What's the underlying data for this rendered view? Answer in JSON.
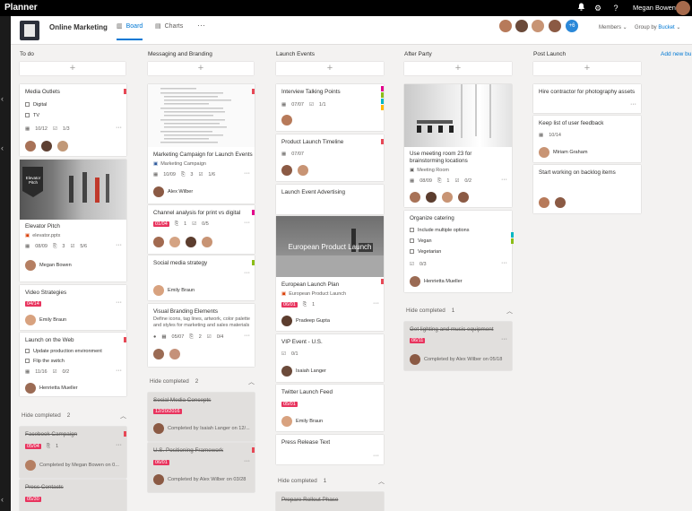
{
  "app": {
    "title": "Planner",
    "user": "Megan Bowen"
  },
  "header": {
    "plan_name": "Online Marketing",
    "tabs": [
      {
        "label": "Board"
      },
      {
        "label": "Charts"
      }
    ],
    "more": "···",
    "extra_members": "+6",
    "members_label": "Members",
    "group_prefix": "Group by",
    "group_value": "Bucket"
  },
  "board": {
    "add_bucket": "Add new bu",
    "add_symbol": "+",
    "more": "···",
    "to_do": {
      "title": "To do",
      "media_outlets": {
        "title": "Media Outlets",
        "check1": "Digital",
        "check2": "TV",
        "date": "10/12",
        "progress": "1/3"
      },
      "elevator": {
        "img_title": "Elevator Pitch",
        "title": "Elevator Pitch",
        "file": "elevator.pptx",
        "date": "08/09",
        "attach": "3",
        "progress": "5/6",
        "person": "Megan Bowen"
      },
      "video": {
        "title": "Video Strategies",
        "date": "04/14",
        "person": "Emily Braun"
      },
      "launch_web": {
        "title": "Launch on the Web",
        "check1": "Update production environment",
        "check2": "Flip the switch",
        "date": "11/16",
        "progress": "0/2",
        "person": "Henrietta Mueller"
      },
      "hide_completed": "Hide completed",
      "completed_count": "2",
      "fb": {
        "title": "Facebook Campaign",
        "date": "05/04",
        "attach": "1",
        "status": "Completed by Megan Bowen on 0..."
      },
      "press": {
        "title": "Press Contacts",
        "date": "05/30"
      }
    },
    "messaging": {
      "title": "Messaging and Branding",
      "campaign": {
        "title": "Marketing Campaign for Launch Events",
        "file": "Marketing Campaign",
        "date": "10/09",
        "attach": "3",
        "progress": "1/6",
        "person": "Alex Wilber"
      },
      "channel": {
        "title": "Channel analysis for print vs digital",
        "date": "01/04",
        "attach": "1",
        "progress": "0/5"
      },
      "social": {
        "title": "Social media strategy",
        "person": "Emily Braun"
      },
      "visual": {
        "title": "Visual Branding Elements",
        "desc": "Define icons, tag lines, artwork, color palette and styles for marketing and sales materials",
        "date": "05/07",
        "attach": "2",
        "progress": "0/4"
      },
      "hide_completed": "Hide completed",
      "completed_count": "2",
      "smc": {
        "title": "Social Media Concepts",
        "date": "12/20/2016",
        "status": "Completed by Isaiah Langer on 12/..."
      },
      "usp": {
        "title": "U.S. Positioning Framework",
        "date": "06/01",
        "status": "Completed by Alex Wilber on 03/28"
      }
    },
    "launch": {
      "title": "Launch Events",
      "interview": {
        "title": "Interview Talking Points",
        "date": "07/07",
        "progress": "1/1"
      },
      "timeline": {
        "title": "Product Launch Timeline",
        "date": "07/07"
      },
      "advert": {
        "title": "Launch Event Advertising"
      },
      "european": {
        "img_title": "European Product Launch",
        "title": "European Launch Plan",
        "file": "European Product Launch",
        "date": "06/01",
        "attach": "1",
        "person": "Pradeep Gupta"
      },
      "vip": {
        "title": "VIP Event - U.S.",
        "progress": "0/1",
        "person": "Isaiah Langer"
      },
      "twitter": {
        "title": "Twitter Launch Feed",
        "date": "05/01",
        "person": "Emily Braun"
      },
      "press": {
        "title": "Press Release Text"
      },
      "hide_completed": "Hide completed",
      "completed_count": "1",
      "rollout": {
        "title": "Prepare Rollout Phase"
      }
    },
    "after_party": {
      "title": "After Party",
      "meeting": {
        "title": "Use meeting room 23 for brainstorming locations",
        "file": "Meeting Room",
        "date": "08/09",
        "attach": "1",
        "progress": "0/2"
      },
      "catering": {
        "title": "Organize catering",
        "check1": "Include multiple options",
        "check2": "Vegan",
        "check3": "Vegetarian",
        "progress": "0/3",
        "person": "Henrietta Mueller"
      },
      "hide_completed": "Hide completed",
      "completed_count": "1",
      "lighting": {
        "title": "Get lighting and music equipment",
        "date": "06/11",
        "status": "Completed by Alex Wilber on 05/18"
      }
    },
    "post_launch": {
      "title": "Post Launch",
      "contractor": {
        "title": "Hire contractor for photography assets"
      },
      "feedback": {
        "title": "Keep list of user feedback",
        "date": "10/14",
        "person": "Miriam Graham"
      },
      "backlog": {
        "title": "Start working on backlog items"
      }
    }
  },
  "colors": {
    "accent": "#0078d4",
    "due": "#e8345e",
    "topbar": "#000000"
  }
}
